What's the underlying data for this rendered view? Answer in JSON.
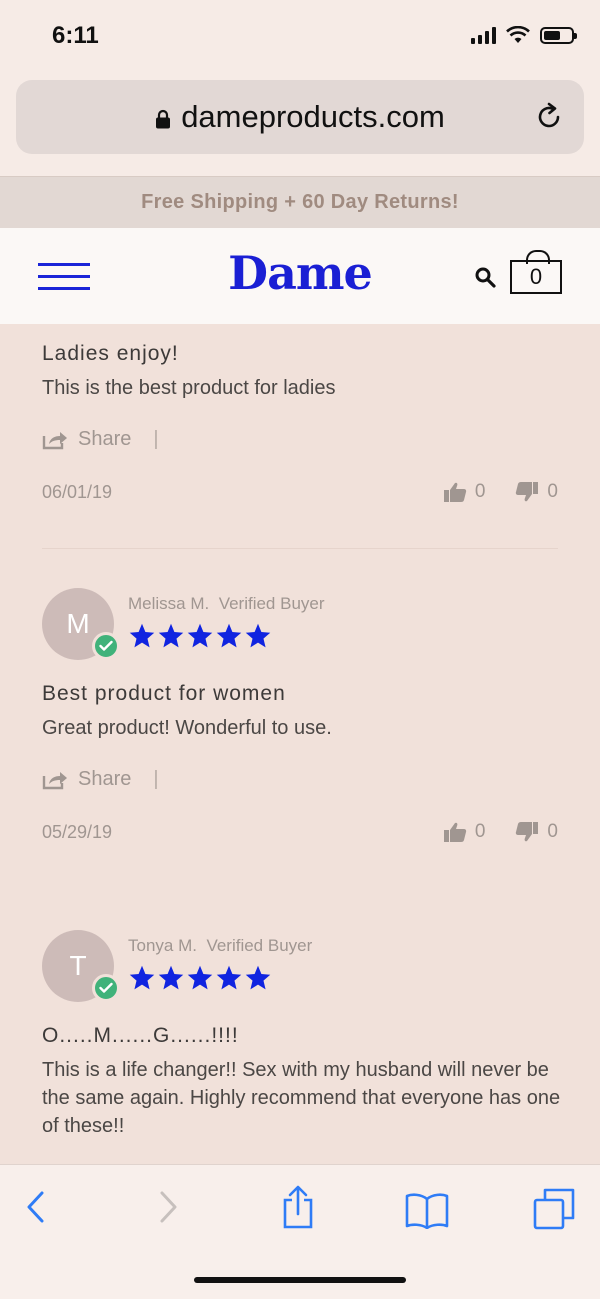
{
  "status_bar": {
    "time": "6:11"
  },
  "browser": {
    "url": "dameproducts.com"
  },
  "banner": {
    "text": "Free Shipping + 60 Day Returns!"
  },
  "header": {
    "brand": "Dame",
    "cart_count": "0"
  },
  "reviews": [
    {
      "title": "Ladies enjoy!",
      "body": "This is the best product for ladies",
      "share_label": "Share",
      "separator": "|",
      "date": "06/01/19",
      "upvotes": "0",
      "downvotes": "0"
    },
    {
      "avatar_initial": "M",
      "reviewer": "Melissa M.",
      "badge": "Verified Buyer",
      "rating": 5,
      "title": "Best product for women",
      "body": "Great product! Wonderful to use.",
      "share_label": "Share",
      "separator": "|",
      "date": "05/29/19",
      "upvotes": "0",
      "downvotes": "0"
    },
    {
      "avatar_initial": "T",
      "reviewer": "Tonya M.",
      "badge": "Verified Buyer",
      "rating": 5,
      "title": "O.....M......G......!!!!",
      "body": "This is a life changer!! Sex with my husband will never be the same again. Highly recommend that everyone has one of these!!"
    }
  ],
  "colors": {
    "brand_blue": "#1a1fd4",
    "star_blue": "#1024e0",
    "verified_green": "#40b27a",
    "page_bg": "#f1e1da"
  }
}
